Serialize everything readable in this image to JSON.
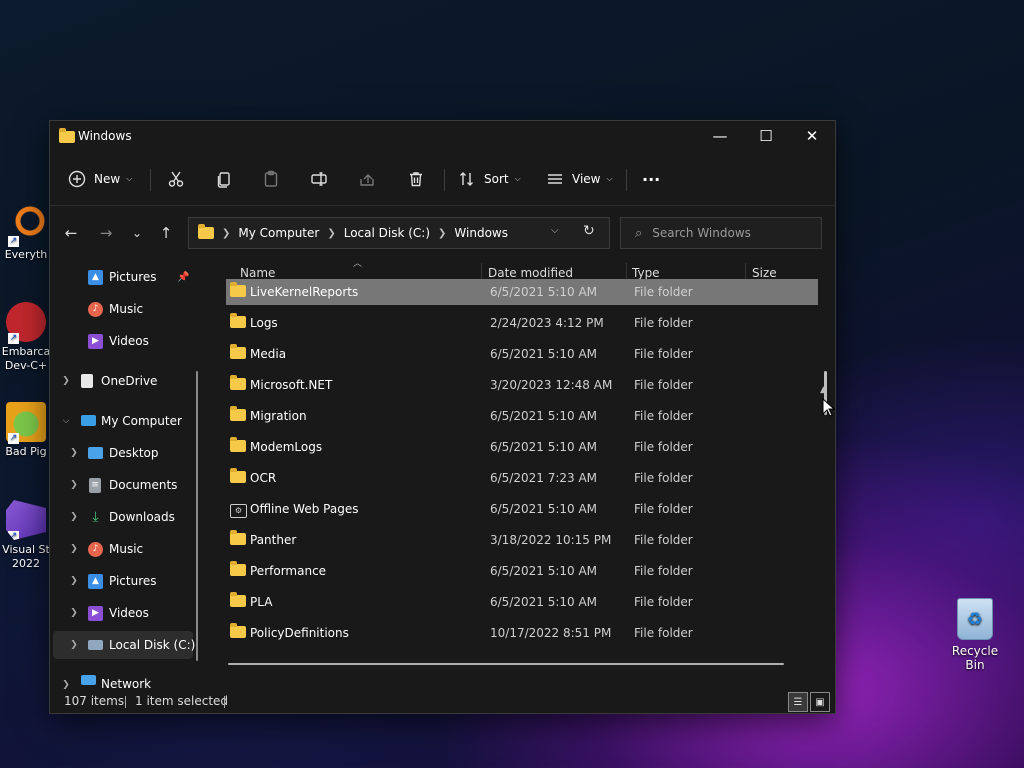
{
  "desktop": {
    "icons": [
      {
        "label": "Everyth",
        "color": "#f07d1a"
      },
      {
        "label": "Embarca\nDev-C+",
        "color": "#c0272d"
      },
      {
        "label": "Bad Pig",
        "color": "#5fae3a"
      },
      {
        "label": "Visual St\n2022",
        "color": "#6b3fc0"
      }
    ],
    "recycle_bin": "Recycle Bin"
  },
  "window": {
    "title": "Windows",
    "controls": {
      "minimize": "—",
      "maximize": "☐",
      "close": "✕"
    }
  },
  "toolbar": {
    "new_label": "New",
    "sort_label": "Sort",
    "view_label": "View",
    "more_label": "···"
  },
  "navigation": {
    "back": "←",
    "forward": "→",
    "recent": "⌄",
    "up": "↑",
    "breadcrumb": [
      "My Computer",
      "Local Disk (C:)",
      "Windows"
    ],
    "search_placeholder": "Search Windows"
  },
  "sidebar": {
    "items": [
      {
        "label": "Pictures",
        "icon": "pictures-icon",
        "color": "#3a8ee6"
      },
      {
        "label": "Music",
        "icon": "music-icon",
        "color": "#e8664e"
      },
      {
        "label": "Videos",
        "icon": "videos-icon",
        "color": "#8b4fd6"
      },
      {
        "label": "OneDrive",
        "icon": "onedrive-icon",
        "color": "#e8e8e8"
      },
      {
        "label": "My Computer",
        "icon": "computer-icon",
        "color": "#3a9ee6"
      },
      {
        "label": "Desktop",
        "icon": "desktop-icon",
        "color": "#4aa3e8"
      },
      {
        "label": "Documents",
        "icon": "documents-icon",
        "color": "#9aa0a8"
      },
      {
        "label": "Downloads",
        "icon": "downloads-icon",
        "color": "#3fbf7a"
      },
      {
        "label": "Music",
        "icon": "music-icon",
        "color": "#e8664e"
      },
      {
        "label": "Pictures",
        "icon": "pictures-icon",
        "color": "#3a8ee6"
      },
      {
        "label": "Videos",
        "icon": "videos-icon",
        "color": "#8b4fd6"
      },
      {
        "label": "Local Disk (C:)",
        "icon": "disk-icon",
        "color": "#8fa8c0"
      },
      {
        "label": "Network",
        "icon": "network-icon",
        "color": "#4aa3e8"
      }
    ]
  },
  "columns": {
    "name": "Name",
    "date": "Date modified",
    "type": "Type",
    "size": "Size"
  },
  "files": [
    {
      "name": "LiveKernelReports",
      "date": "6/5/2021 5:10 AM",
      "type": "File folder"
    },
    {
      "name": "Logs",
      "date": "2/24/2023 4:12 PM",
      "type": "File folder"
    },
    {
      "name": "Media",
      "date": "6/5/2021 5:10 AM",
      "type": "File folder"
    },
    {
      "name": "Microsoft.NET",
      "date": "3/20/2023 12:48 AM",
      "type": "File folder"
    },
    {
      "name": "Migration",
      "date": "6/5/2021 5:10 AM",
      "type": "File folder"
    },
    {
      "name": "ModemLogs",
      "date": "6/5/2021 5:10 AM",
      "type": "File folder"
    },
    {
      "name": "OCR",
      "date": "6/5/2021 7:23 AM",
      "type": "File folder"
    },
    {
      "name": "Offline Web Pages",
      "date": "6/5/2021 5:10 AM",
      "type": "File folder"
    },
    {
      "name": "Panther",
      "date": "3/18/2022 10:15 PM",
      "type": "File folder"
    },
    {
      "name": "Performance",
      "date": "6/5/2021 5:10 AM",
      "type": "File folder"
    },
    {
      "name": "PLA",
      "date": "6/5/2021 5:10 AM",
      "type": "File folder"
    },
    {
      "name": "PolicyDefinitions",
      "date": "10/17/2022 8:51 PM",
      "type": "File folder"
    }
  ],
  "status": {
    "items": "107 items",
    "selected": "1 item selected"
  }
}
